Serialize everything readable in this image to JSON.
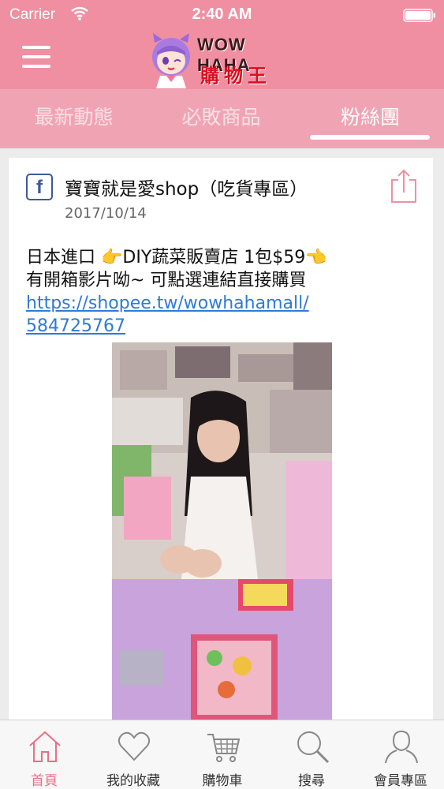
{
  "status_bar": {
    "carrier": "Carrier",
    "time": "2:40 AM"
  },
  "header": {
    "menu_icon": "hamburger-menu-icon",
    "logo_line1": "WOW HAHA",
    "logo_line2": "購物王"
  },
  "tabs": [
    {
      "label": "最新動態",
      "active": false
    },
    {
      "label": "必敗商品",
      "active": false
    },
    {
      "label": "粉絲團",
      "active": true
    }
  ],
  "post": {
    "source_icon": "facebook-icon",
    "title": "寶寶就是愛shop（吃貨專區）",
    "date": "2017/10/14",
    "body_line1": "日本進口 👉DIY蔬菜販賣店  1包$59👈",
    "body_line2": "有開箱影片呦~  可點選連結直接購買",
    "link_line1": "https://shopee.tw/wowhahamall/",
    "link_line2": "584725767"
  },
  "bottom_nav": [
    {
      "label": "首頁",
      "icon": "home-icon",
      "active": true
    },
    {
      "label": "我的收藏",
      "icon": "heart-icon",
      "active": false
    },
    {
      "label": "購物車",
      "icon": "cart-icon",
      "active": false
    },
    {
      "label": "搜尋",
      "icon": "search-icon",
      "active": false
    },
    {
      "label": "會員專區",
      "icon": "user-icon",
      "active": false
    }
  ],
  "colors": {
    "header_pink": "#f08fa2",
    "tab_pink": "#f0a4b3",
    "active_nav": "#ea6f86",
    "link_blue": "#2f7ad6"
  }
}
